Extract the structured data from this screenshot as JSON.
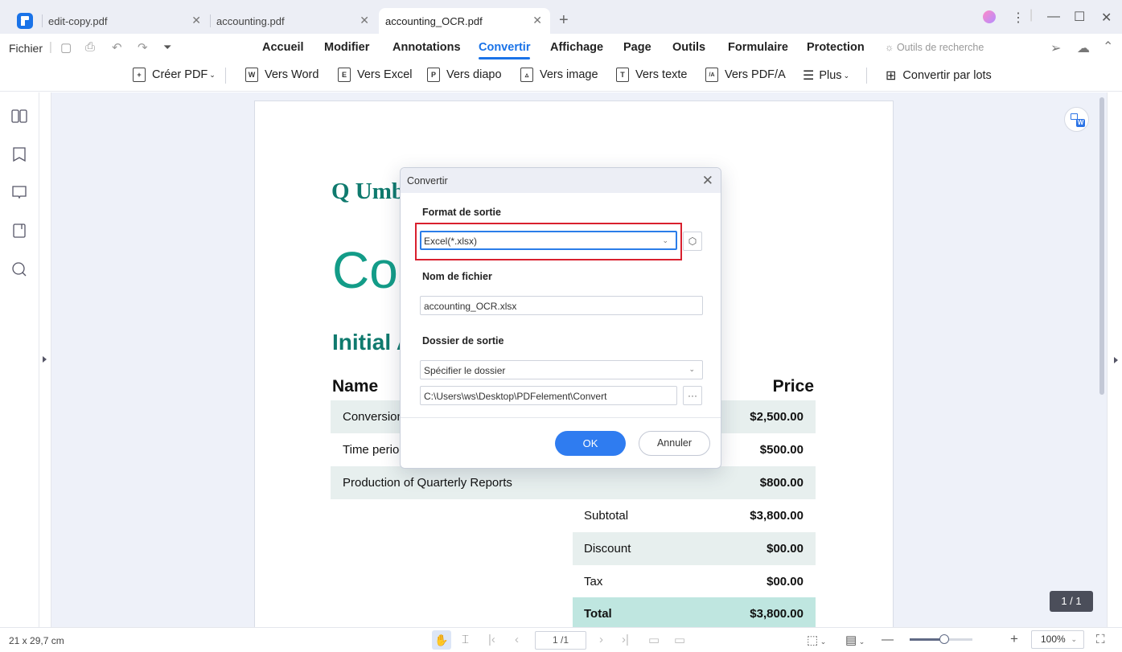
{
  "tabs": [
    {
      "label": "edit-copy.pdf",
      "active": false
    },
    {
      "label": "accounting.pdf",
      "active": false
    },
    {
      "label": "accounting_OCR.pdf",
      "active": true
    }
  ],
  "menu": {
    "fichier": "Fichier",
    "items": [
      "Accueil",
      "Modifier",
      "Annotations",
      "Convertir",
      "Affichage",
      "Page",
      "Outils",
      "Formulaire",
      "Protection"
    ],
    "active": "Convertir",
    "research": "Outils de recherche"
  },
  "toolbar": {
    "create_pdf": "Créer PDF",
    "to_word": "Vers Word",
    "to_excel": "Vers Excel",
    "to_ppt": "Vers diapo",
    "to_image": "Vers image",
    "to_text": "Vers texte",
    "to_pdfa": "Vers PDF/A",
    "more": "Plus",
    "batch": "Convertir par lots"
  },
  "document": {
    "company": "Q Umb",
    "title": "Cos",
    "subtitle": "Initial A",
    "col_name": "Name",
    "col_price": "Price",
    "rows": [
      {
        "name": "Conversion",
        "price": "$2,500.00"
      },
      {
        "name": "Time perioc",
        "price": "$500.00"
      },
      {
        "name": "Production of Quarterly Reports",
        "price": "$800.00"
      }
    ],
    "summary": [
      {
        "label": "Subtotal",
        "value": "$3,800.00"
      },
      {
        "label": "Discount",
        "value": "$00.00"
      },
      {
        "label": "Tax",
        "value": "$00.00"
      },
      {
        "label": "Total",
        "value": "$3,800.00"
      }
    ]
  },
  "dialog": {
    "title": "Convertir",
    "output_format_label": "Format de sortie",
    "output_format_value": "Excel(*.xlsx)",
    "filename_label": "Nom de fichier",
    "filename_value": "accounting_OCR.xlsx",
    "folder_label": "Dossier de sortie",
    "folder_option": "Spécifier le dossier",
    "folder_path": "C:\\Users\\ws\\Desktop\\PDFelement\\Convert",
    "browse": "···",
    "ok": "OK",
    "cancel": "Annuler"
  },
  "page_badge": "1 / 1",
  "status": {
    "dimensions": "21 x 29,7 cm",
    "page_input": "1 /1",
    "zoom_level": "100%",
    "zoom_fraction": 0.55
  }
}
